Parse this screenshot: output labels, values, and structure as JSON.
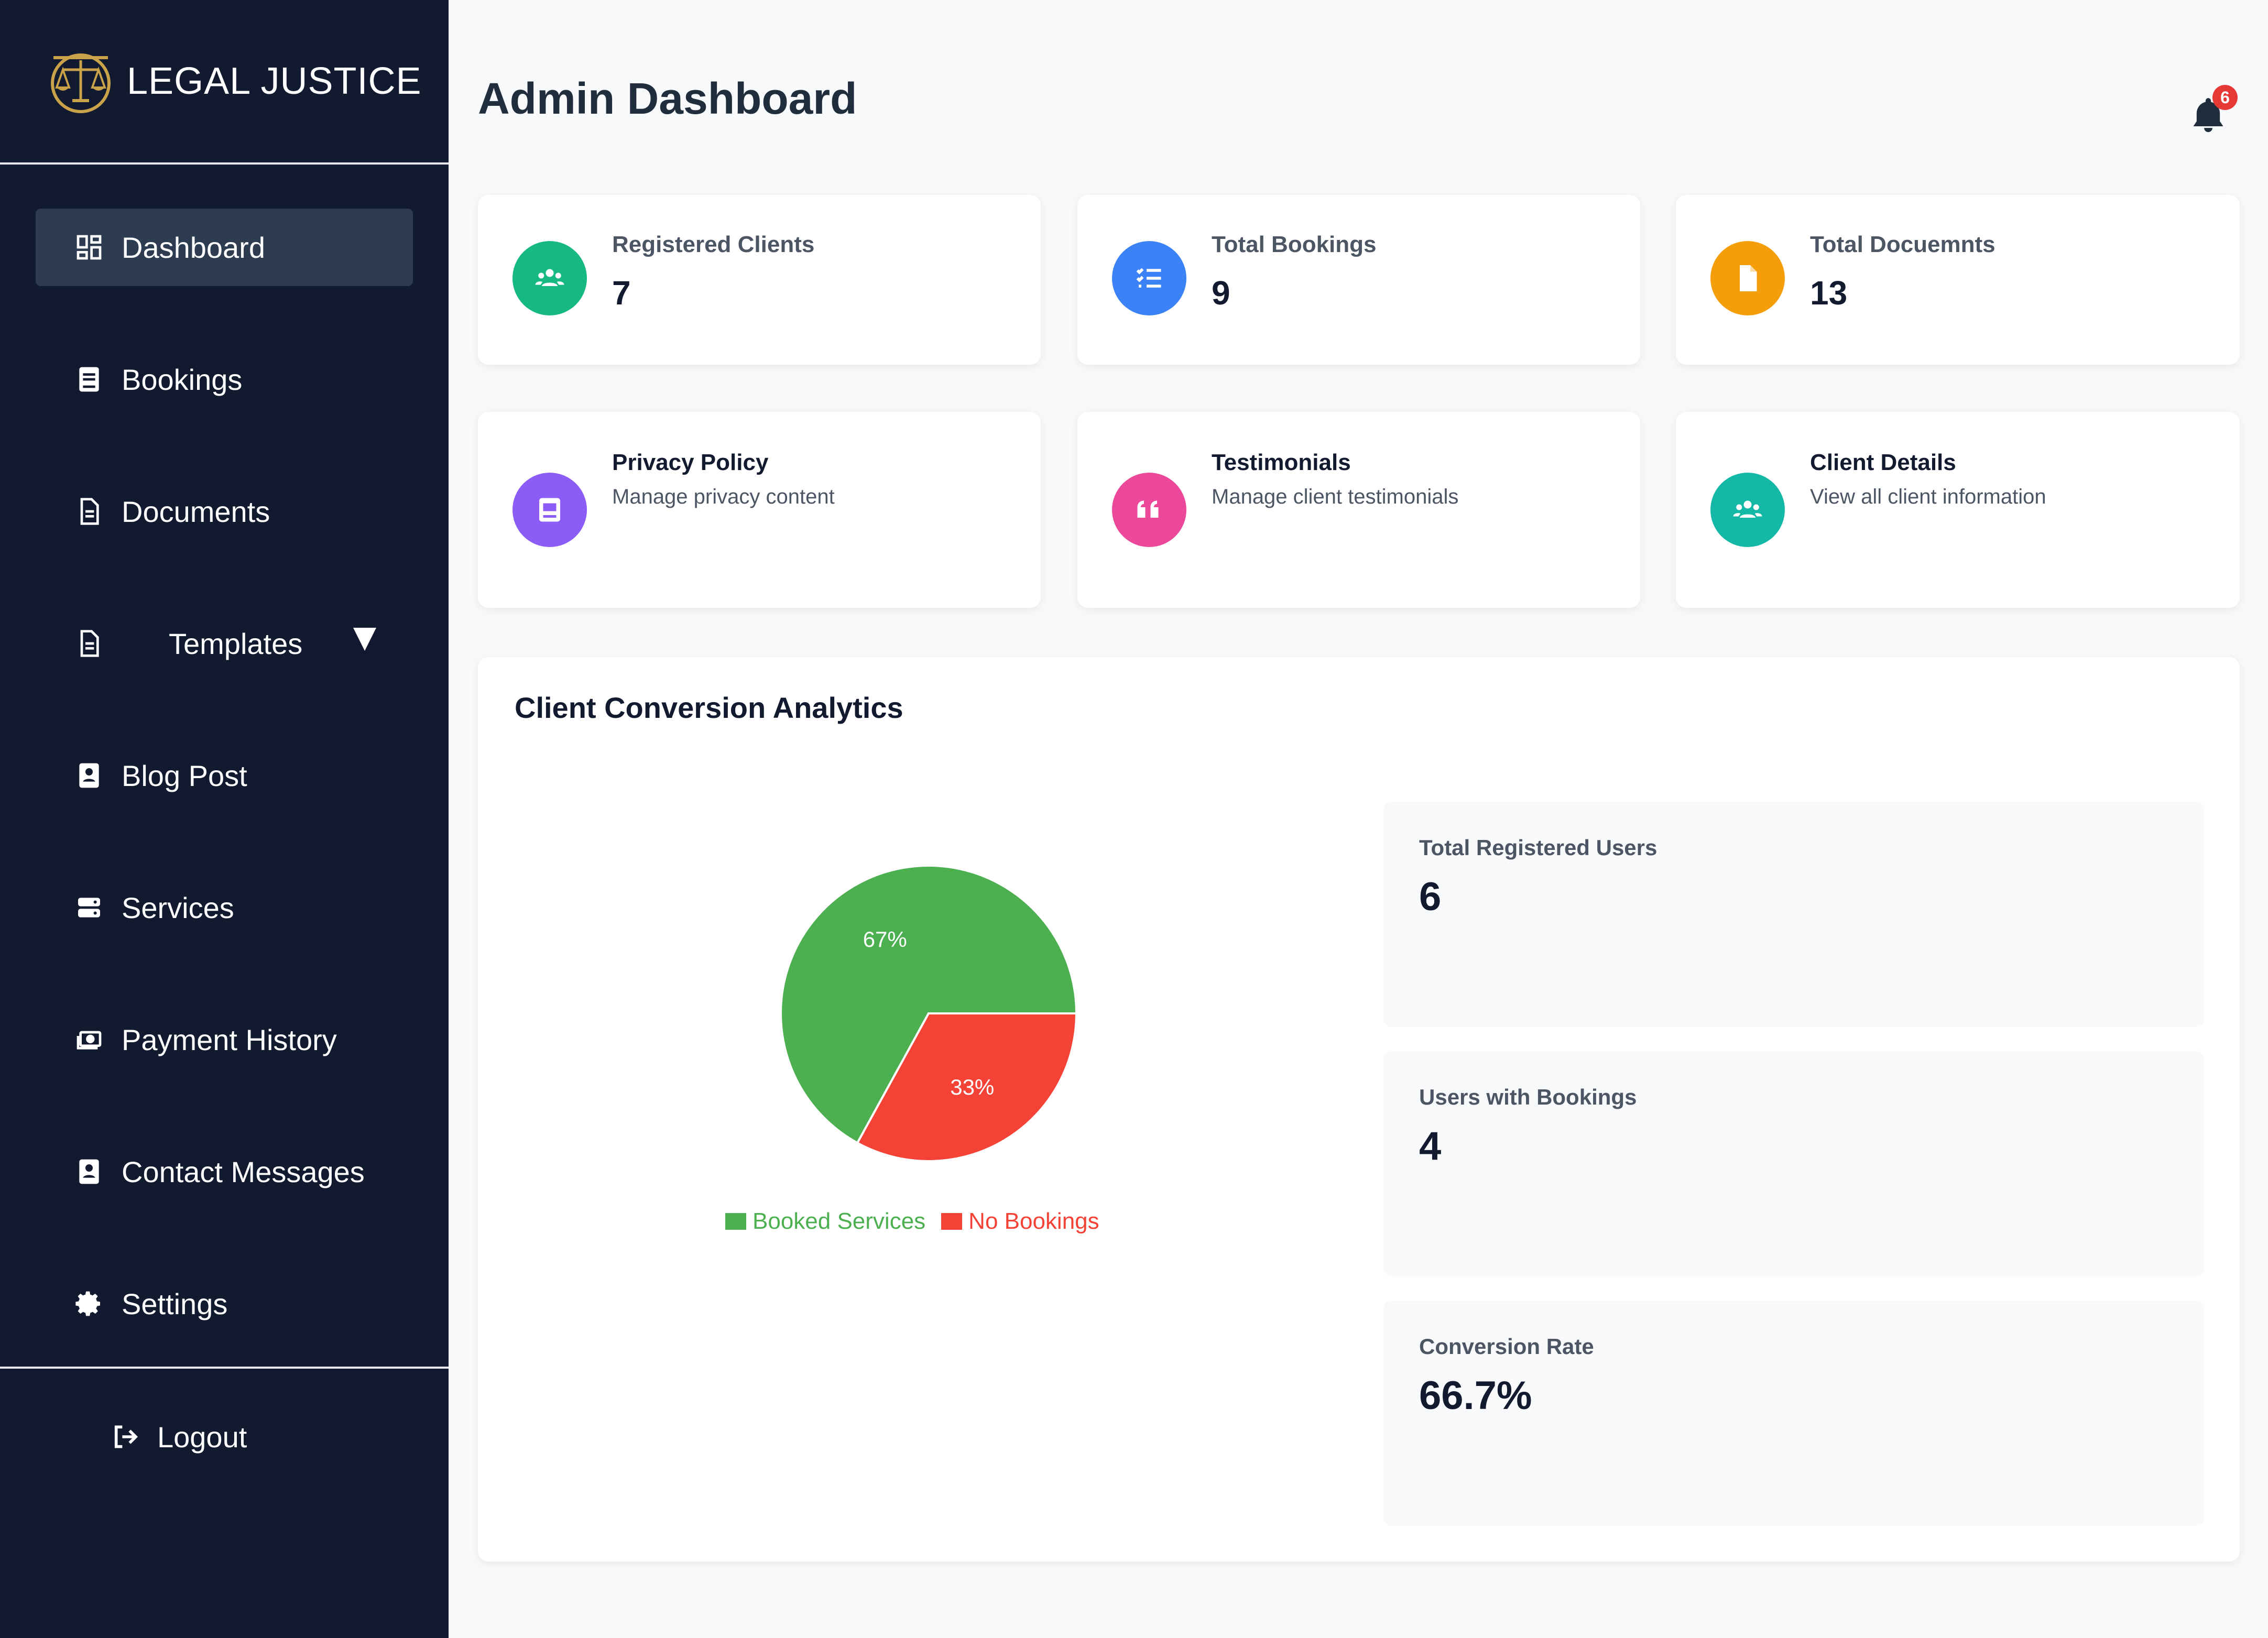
{
  "brand": {
    "name": "LEGAL JUSTICE"
  },
  "sidebar": {
    "items": [
      {
        "label": "Dashboard",
        "icon": "dashboard-icon"
      },
      {
        "label": "Bookings",
        "icon": "bookings-icon"
      },
      {
        "label": "Documents",
        "icon": "document-icon"
      },
      {
        "label": "Templates",
        "icon": "template-icon"
      },
      {
        "label": "Blog Post",
        "icon": "blog-icon"
      },
      {
        "label": "Services",
        "icon": "services-icon"
      },
      {
        "label": "Payment History",
        "icon": "payment-icon"
      },
      {
        "label": "Contact Messages",
        "icon": "contact-icon"
      },
      {
        "label": "Settings",
        "icon": "gear-icon"
      }
    ],
    "logout": {
      "label": "Logout",
      "icon": "logout-icon"
    }
  },
  "header": {
    "title": "Admin Dashboard",
    "notifications": "6"
  },
  "stats": [
    {
      "title": "Registered Clients",
      "value": "7",
      "color": "#16b981",
      "icon": "users-icon"
    },
    {
      "title": "Total Bookings",
      "value": "9",
      "color": "#3b82f6",
      "icon": "list-icon"
    },
    {
      "title": "Total Docuemnts",
      "value": "13",
      "color": "#f59e0b",
      "icon": "file-icon"
    }
  ],
  "quick_links": [
    {
      "title": "Privacy Policy",
      "subtitle": "Manage privacy content",
      "color": "#8b5cf6",
      "icon": "privacy-icon"
    },
    {
      "title": "Testimonials",
      "subtitle": "Manage client testimonials",
      "color": "#ec4899",
      "icon": "quote-icon"
    },
    {
      "title": "Client Details",
      "subtitle": "View all client information",
      "color": "#14b8a6",
      "icon": "users-icon"
    }
  ],
  "analytics": {
    "title": "Client Conversion Analytics",
    "metrics": [
      {
        "label": "Total Registered Users",
        "value": "6"
      },
      {
        "label": "Users with Bookings",
        "value": "4"
      },
      {
        "label": "Conversion Rate",
        "value": "66.7%"
      }
    ]
  },
  "chart_data": {
    "type": "pie",
    "categories": [
      "Booked Services",
      "No Bookings"
    ],
    "values": [
      67,
      33
    ],
    "labels": [
      "67%",
      "33%"
    ],
    "colors": [
      "#4caf50",
      "#f44336"
    ],
    "legend": "bottom"
  }
}
